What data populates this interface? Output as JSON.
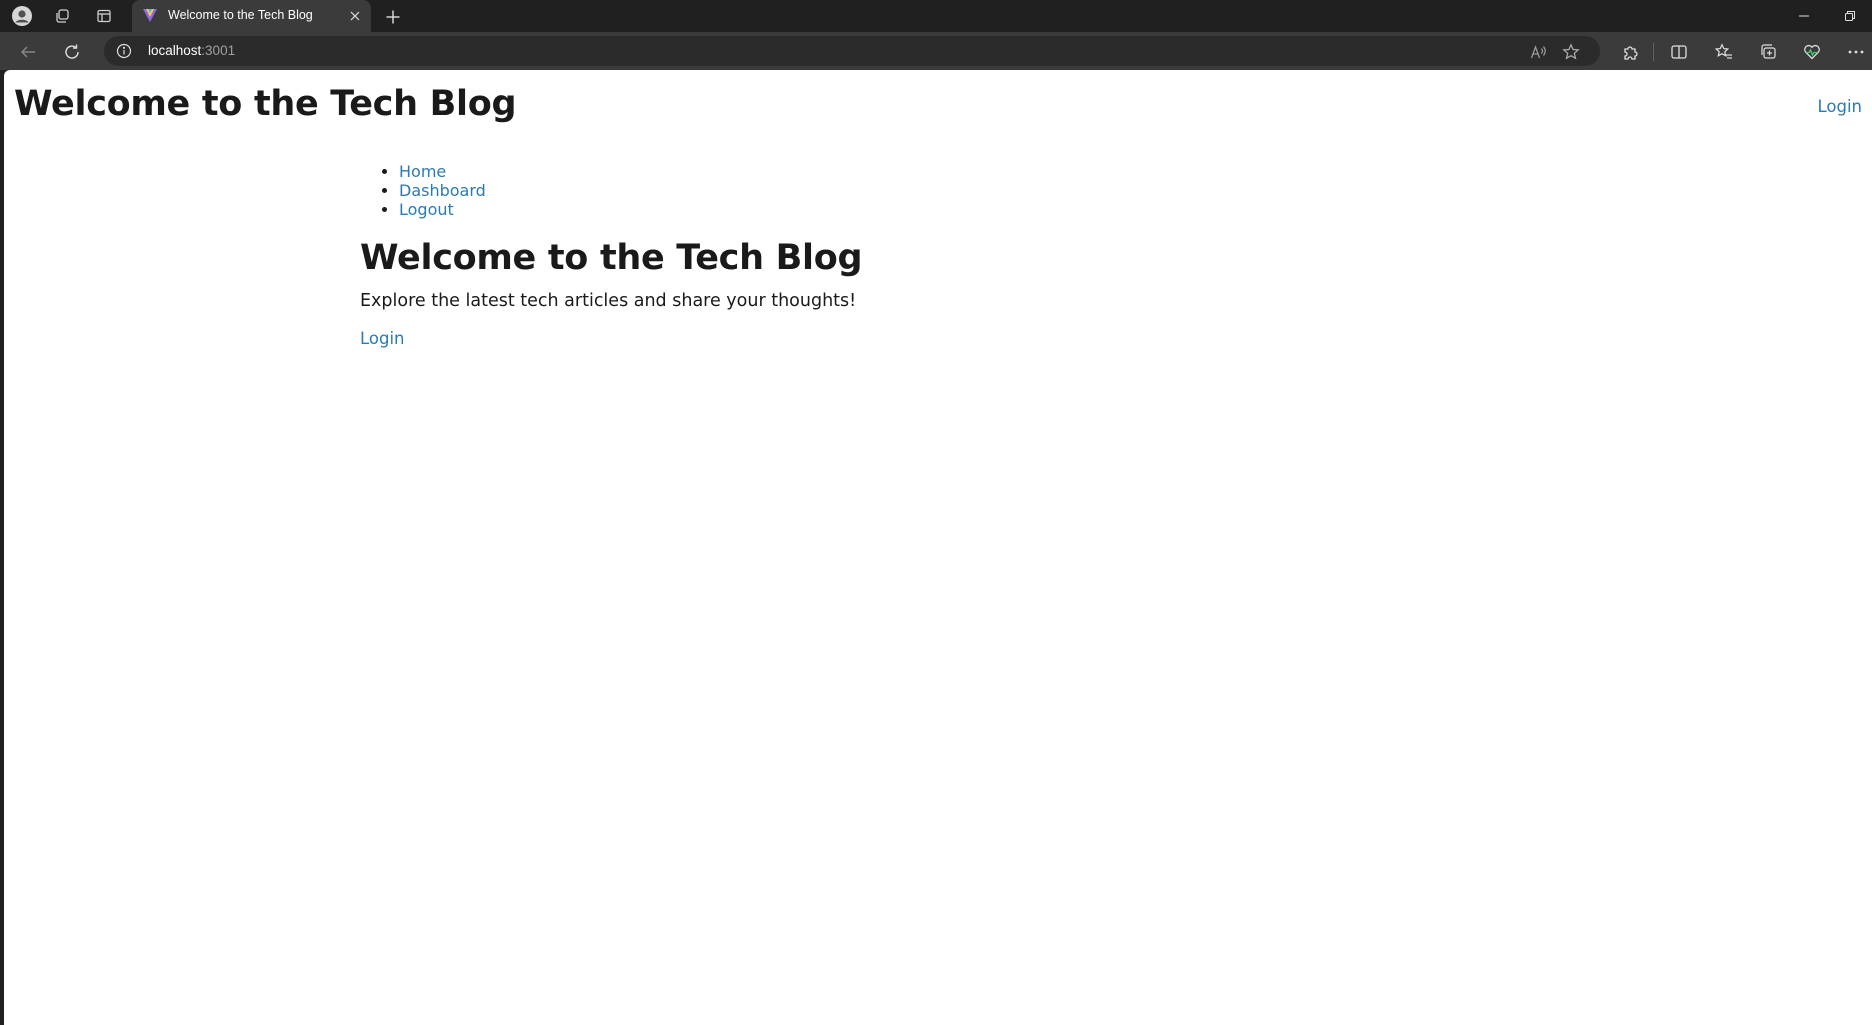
{
  "browser": {
    "tab_title": "Welcome to the Tech Blog",
    "url_host": "localhost",
    "url_port": ":3001"
  },
  "page": {
    "header_title": "Welcome to the Tech Blog",
    "header_login": "Login",
    "nav": [
      {
        "label": "Home"
      },
      {
        "label": "Dashboard"
      },
      {
        "label": "Logout"
      }
    ],
    "main_title": "Welcome to the Tech Blog",
    "main_description": "Explore the latest tech articles and share your thoughts!",
    "main_login": "Login"
  },
  "colors": {
    "link": "#2a7bb3",
    "text": "#1a1a1a",
    "chrome_dark": "#202020",
    "chrome_toolbar": "#3b3b3b"
  }
}
